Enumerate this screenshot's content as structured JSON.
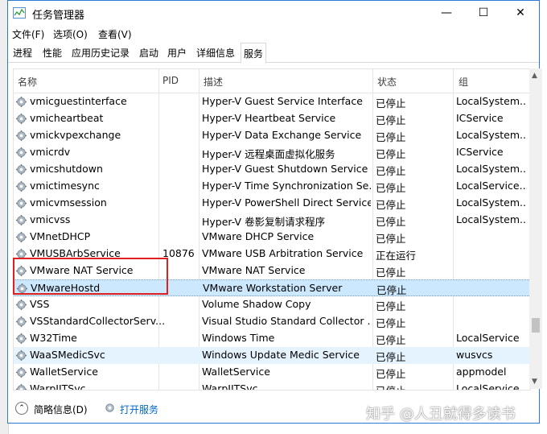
{
  "window": {
    "title": "任务管理器",
    "controls": {
      "minimize": "—",
      "maximize": "☐",
      "close": "✕"
    }
  },
  "menu": [
    "文件(F)",
    "选项(O)",
    "查看(V)"
  ],
  "tabs": [
    "进程",
    "性能",
    "应用历史记录",
    "启动",
    "用户",
    "详细信息",
    "服务"
  ],
  "active_tab": "服务",
  "columns": {
    "name": "名称",
    "pid": "PID",
    "desc": "描述",
    "status": "状态",
    "group": "组"
  },
  "rows": [
    {
      "name": "vmicguestinterface",
      "pid": "",
      "desc": "Hyper-V Guest Service Interface",
      "status": "已停止",
      "group": "LocalSystem..."
    },
    {
      "name": "vmicheartbeat",
      "pid": "",
      "desc": "Hyper-V Heartbeat Service",
      "status": "已停止",
      "group": "ICService"
    },
    {
      "name": "vmickvpexchange",
      "pid": "",
      "desc": "Hyper-V Data Exchange Service",
      "status": "已停止",
      "group": "LocalSystem..."
    },
    {
      "name": "vmicrdv",
      "pid": "",
      "desc": "Hyper-V 远程桌面虚拟化服务",
      "status": "已停止",
      "group": "ICService"
    },
    {
      "name": "vmicshutdown",
      "pid": "",
      "desc": "Hyper-V Guest Shutdown Service",
      "status": "已停止",
      "group": "LocalSystem..."
    },
    {
      "name": "vmictimesync",
      "pid": "",
      "desc": "Hyper-V Time Synchronization Se...",
      "status": "已停止",
      "group": "LocalService..."
    },
    {
      "name": "vmicvmsession",
      "pid": "",
      "desc": "Hyper-V PowerShell Direct Service",
      "status": "已停止",
      "group": "LocalSystem..."
    },
    {
      "name": "vmicvss",
      "pid": "",
      "desc": "Hyper-V 卷影复制请求程序",
      "status": "已停止",
      "group": "LocalSystem..."
    },
    {
      "name": "VMnetDHCP",
      "pid": "",
      "desc": "VMware DHCP Service",
      "status": "已停止",
      "group": ""
    },
    {
      "name": "VMUSBArbService",
      "pid": "10876",
      "desc": "VMware USB Arbitration Service",
      "status": "正在运行",
      "group": ""
    },
    {
      "name": "VMware NAT Service",
      "pid": "",
      "desc": "VMware NAT Service",
      "status": "已停止",
      "group": ""
    },
    {
      "name": "VMwareHostd",
      "pid": "",
      "desc": "VMware Workstation Server",
      "status": "已停止",
      "group": ""
    },
    {
      "name": "VSS",
      "pid": "",
      "desc": "Volume Shadow Copy",
      "status": "已停止",
      "group": ""
    },
    {
      "name": "VSStandardCollectorServ...",
      "pid": "",
      "desc": "Visual Studio Standard Collector ...",
      "status": "已停止",
      "group": ""
    },
    {
      "name": "W32Time",
      "pid": "",
      "desc": "Windows Time",
      "status": "已停止",
      "group": "LocalService"
    },
    {
      "name": "WaaSMedicSvc",
      "pid": "",
      "desc": "Windows Update Medic Service",
      "status": "已停止",
      "group": "wusvcs"
    },
    {
      "name": "WalletService",
      "pid": "",
      "desc": "WalletService",
      "status": "已停止",
      "group": "appmodel"
    },
    {
      "name": "WarpJITSvc",
      "pid": "",
      "desc": "WarpJITSvc",
      "status": "已停止",
      "group": "LocalService..."
    }
  ],
  "selected_row": "VMwareHostd",
  "hover_row": "WaaSMedicSvc",
  "footer": {
    "toggle_icon": "chevron-up-icon",
    "less_details": "简略信息(D)",
    "open_services": "打开服务"
  },
  "watermark": "知乎 @人丑就得多读书",
  "colors": {
    "selection": "#cce8ff",
    "hover": "#e5f3ff",
    "annotation": "#e02020",
    "link": "#0066cc",
    "window_border": "#2b78d5"
  }
}
